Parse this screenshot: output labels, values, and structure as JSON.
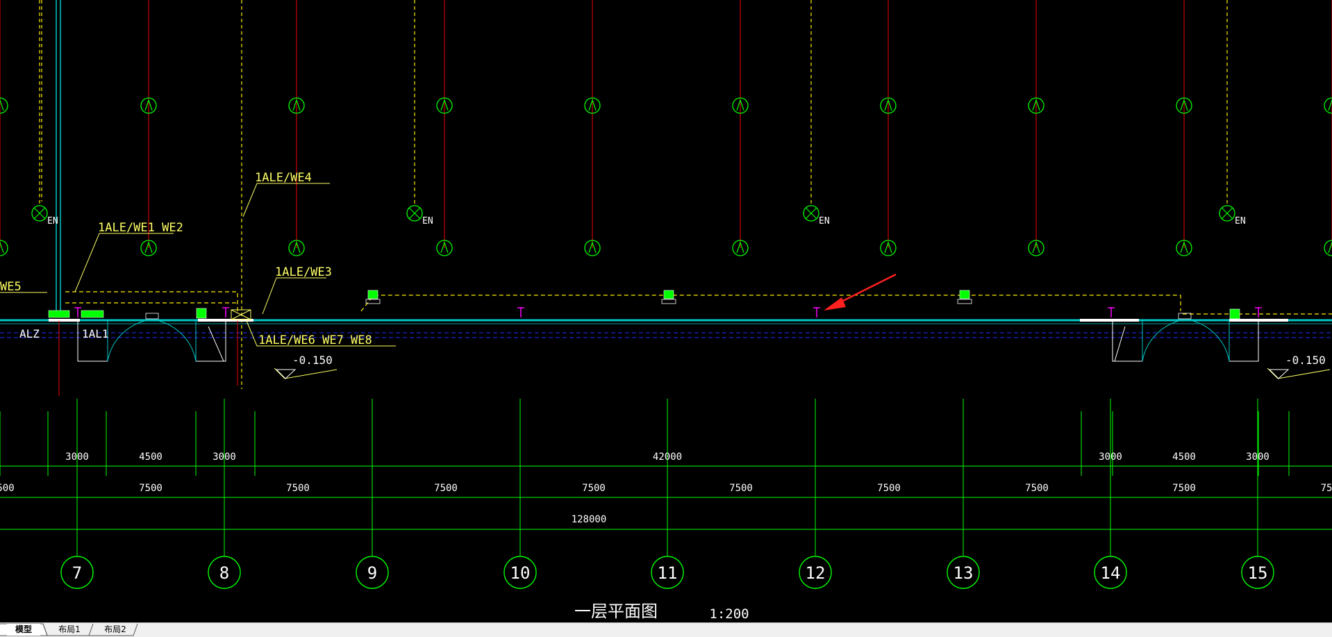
{
  "colors": {
    "background": "#000000",
    "wire_red": "#cc0000",
    "wire_yellow": "#ffee00",
    "grid_green": "#00ff00",
    "wall_cyan": "#00c8c8",
    "label_yellow": "#ffff66",
    "magenta_marker": "#ff00ff",
    "arrow_red": "#ff2020",
    "dim_text": "#ffffff"
  },
  "drawing": {
    "circuit_labels": {
      "we5": "WE5",
      "we1_we2": "1ALE/WE1 WE2",
      "we4": "1ALE/WE4",
      "we3": "1ALE/WE3",
      "we6_we7_we8": "1ALE/WE6 WE7 WE8"
    },
    "panel_labels": {
      "alz": "ALZ",
      "al1": "1AL1"
    },
    "emergency_label": "EN",
    "level_marks": [
      "-0.150",
      "-0.150"
    ],
    "dim_row1": [
      "3000",
      "4500",
      "3000",
      "42000",
      "3000",
      "4500",
      "3000"
    ],
    "dim_row2": [
      "500",
      "7500",
      "7500",
      "7500",
      "7500",
      "7500",
      "7500",
      "7500",
      "7500",
      "75"
    ],
    "dim_total": "128000",
    "axis_numbers": [
      "7",
      "8",
      "9",
      "10",
      "11",
      "12",
      "13",
      "14",
      "15"
    ],
    "plan_title": "一层平面图",
    "scale": "1:200"
  },
  "tabs": [
    {
      "label": "模型",
      "active": true
    },
    {
      "label": "布局1",
      "active": false
    },
    {
      "label": "布局2",
      "active": false
    }
  ]
}
